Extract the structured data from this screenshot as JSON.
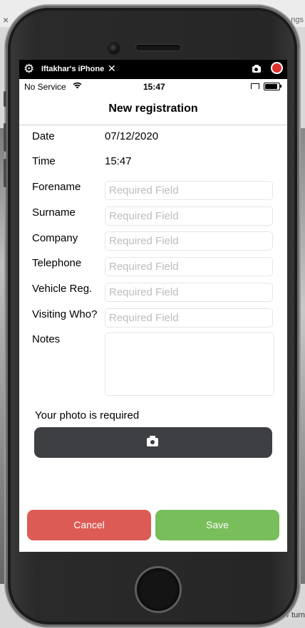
{
  "background": {
    "left_close": "×",
    "right_tab_fragment": "ngs",
    "bottom_right_fragment": "/ turn"
  },
  "mirror_bar": {
    "device_name": "Iftakhar's iPhone",
    "close_glyph": "✕",
    "icons": [
      "gear-icon",
      "camera-icon",
      "record-icon"
    ]
  },
  "status_bar": {
    "carrier": "No Service",
    "time": "15:47"
  },
  "nav": {
    "title": "New registration"
  },
  "form": {
    "date_label": "Date",
    "date_value": "07/12/2020",
    "time_label": "Time",
    "time_value": "15:47",
    "forename_label": "Forename",
    "surname_label": "Surname",
    "company_label": "Company",
    "telephone_label": "Telephone",
    "vehicle_label": "Vehicle Reg.",
    "visiting_label": "Visiting Who?",
    "notes_label": "Notes",
    "placeholder": "Required Field"
  },
  "photo": {
    "label": "Your photo is required",
    "button_icon": "camera-icon"
  },
  "actions": {
    "cancel": "Cancel",
    "save": "Save"
  },
  "colors": {
    "cancel": "#dc5c55",
    "save": "#78be5a",
    "photo_button": "#3d3f43",
    "record": "#e03030"
  }
}
